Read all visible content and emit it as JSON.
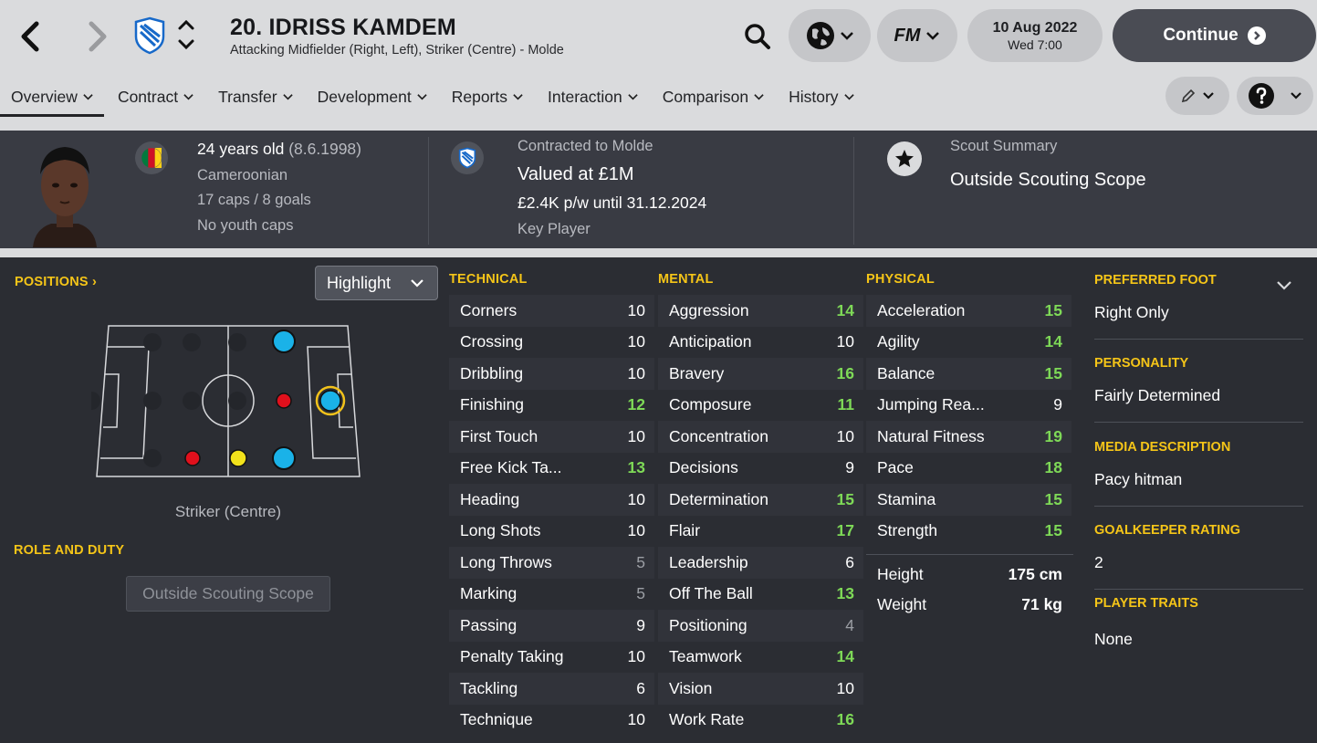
{
  "header": {
    "title": "20. IDRISS KAMDEM",
    "subtitle": "Attacking Midfielder (Right, Left), Striker (Centre) - Molde",
    "date": "10 Aug 2022",
    "time": "Wed 7:00",
    "continue_label": "Continue",
    "fm_label": "FM"
  },
  "tabs": [
    {
      "label": "Overview"
    },
    {
      "label": "Contract"
    },
    {
      "label": "Transfer"
    },
    {
      "label": "Development"
    },
    {
      "label": "Reports"
    },
    {
      "label": "Interaction"
    },
    {
      "label": "Comparison"
    },
    {
      "label": "History"
    }
  ],
  "info": {
    "age": "24 years old",
    "dob": "(8.6.1998)",
    "nationality": "Cameroonian",
    "caps": "17 caps / 8 goals",
    "youth_caps": "No youth caps",
    "contract": "Contracted to Molde",
    "value": "Valued at £1M",
    "wage": "£2.4K p/w until 31.12.2024",
    "status": "Key Player",
    "scout_label": "Scout Summary",
    "scout_value": "Outside Scouting Scope"
  },
  "positions": {
    "heading": "POSITIONS",
    "highlight_label": "Highlight",
    "caption": "Striker (Centre)",
    "role_heading": "ROLE AND DUTY",
    "role_value": "Outside Scouting Scope"
  },
  "technical": {
    "heading": "TECHNICAL",
    "rows": [
      {
        "name": "Corners",
        "value": "10",
        "tone": ""
      },
      {
        "name": "Crossing",
        "value": "10",
        "tone": ""
      },
      {
        "name": "Dribbling",
        "value": "10",
        "tone": ""
      },
      {
        "name": "Finishing",
        "value": "12",
        "tone": "hi"
      },
      {
        "name": "First Touch",
        "value": "10",
        "tone": ""
      },
      {
        "name": "Free Kick Ta...",
        "value": "13",
        "tone": "hi"
      },
      {
        "name": "Heading",
        "value": "10",
        "tone": ""
      },
      {
        "name": "Long Shots",
        "value": "10",
        "tone": ""
      },
      {
        "name": "Long Throws",
        "value": "5",
        "tone": "lo"
      },
      {
        "name": "Marking",
        "value": "5",
        "tone": "lo"
      },
      {
        "name": "Passing",
        "value": "9",
        "tone": ""
      },
      {
        "name": "Penalty Taking",
        "value": "10",
        "tone": ""
      },
      {
        "name": "Tackling",
        "value": "6",
        "tone": ""
      },
      {
        "name": "Technique",
        "value": "10",
        "tone": ""
      }
    ]
  },
  "mental": {
    "heading": "MENTAL",
    "rows": [
      {
        "name": "Aggression",
        "value": "14",
        "tone": "hi"
      },
      {
        "name": "Anticipation",
        "value": "10",
        "tone": ""
      },
      {
        "name": "Bravery",
        "value": "16",
        "tone": "hi"
      },
      {
        "name": "Composure",
        "value": "11",
        "tone": "hi"
      },
      {
        "name": "Concentration",
        "value": "10",
        "tone": ""
      },
      {
        "name": "Decisions",
        "value": "9",
        "tone": ""
      },
      {
        "name": "Determination",
        "value": "15",
        "tone": "hi"
      },
      {
        "name": "Flair",
        "value": "17",
        "tone": "hi"
      },
      {
        "name": "Leadership",
        "value": "6",
        "tone": ""
      },
      {
        "name": "Off The Ball",
        "value": "13",
        "tone": "hi"
      },
      {
        "name": "Positioning",
        "value": "4",
        "tone": "lo"
      },
      {
        "name": "Teamwork",
        "value": "14",
        "tone": "hi"
      },
      {
        "name": "Vision",
        "value": "10",
        "tone": ""
      },
      {
        "name": "Work Rate",
        "value": "16",
        "tone": "hi"
      }
    ]
  },
  "physical": {
    "heading": "PHYSICAL",
    "rows": [
      {
        "name": "Acceleration",
        "value": "15",
        "tone": "hi"
      },
      {
        "name": "Agility",
        "value": "14",
        "tone": "hi"
      },
      {
        "name": "Balance",
        "value": "15",
        "tone": "hi"
      },
      {
        "name": "Jumping Rea...",
        "value": "9",
        "tone": ""
      },
      {
        "name": "Natural Fitness",
        "value": "19",
        "tone": "hi"
      },
      {
        "name": "Pace",
        "value": "18",
        "tone": "hi"
      },
      {
        "name": "Stamina",
        "value": "15",
        "tone": "hi"
      },
      {
        "name": "Strength",
        "value": "15",
        "tone": "hi"
      }
    ],
    "height_label": "Height",
    "height_value": "175 cm",
    "weight_label": "Weight",
    "weight_value": "71 kg"
  },
  "side": {
    "foot_heading": "PREFERRED FOOT",
    "foot_value": "Right Only",
    "personality_heading": "PERSONALITY",
    "personality_value": "Fairly Determined",
    "media_heading": "MEDIA DESCRIPTION",
    "media_value": "Pacy hitman",
    "gk_heading": "GOALKEEPER RATING",
    "gk_value": "2",
    "traits_heading": "PLAYER TRAITS",
    "traits_value": "None"
  },
  "colors": {
    "accent_yellow": "#f5c518",
    "good_green": "#7ed957",
    "natural_blue": "#1ab2e8",
    "competent_yellow": "#f2e21b",
    "unconvincing_red": "#e0101c"
  }
}
